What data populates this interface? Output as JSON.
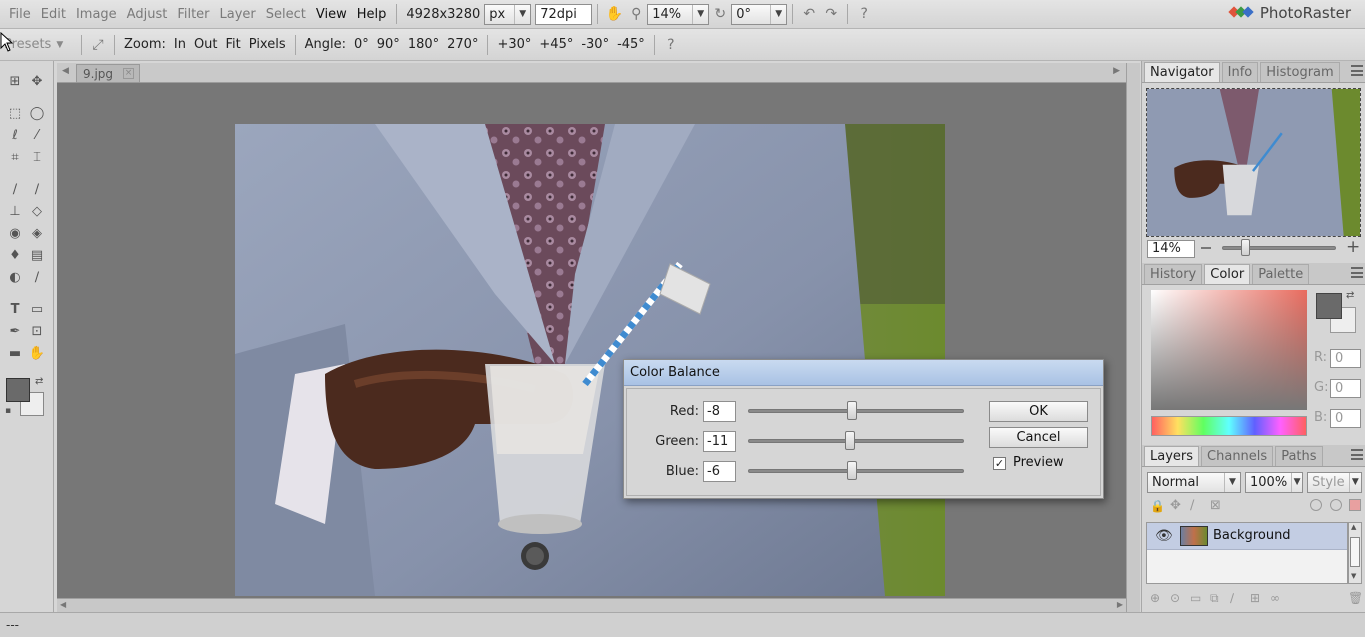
{
  "menu": [
    "File",
    "Edit",
    "Image",
    "Adjust",
    "Filter",
    "Layer",
    "Select",
    "View",
    "Help"
  ],
  "menu_enabled": [
    false,
    false,
    false,
    false,
    false,
    false,
    false,
    true,
    true
  ],
  "image_size": "4928x3280",
  "unit": "px",
  "dpi": "72dpi",
  "zoom_value": "14%",
  "rotate_value": "0°",
  "app_name": "PhotoRaster",
  "options": {
    "presets": "Presets",
    "zoom_label": "Zoom:",
    "zoom_in": "In",
    "zoom_out": "Out",
    "zoom_fit": "Fit",
    "zoom_pixels": "Pixels",
    "angle_label": "Angle:",
    "angles": [
      "0°",
      "90°",
      "180°",
      "270°",
      "+30°",
      "+45°",
      "-30°",
      "-45°"
    ]
  },
  "document": {
    "tab_name": "9.jpg"
  },
  "navigator": {
    "tabs": [
      "Navigator",
      "Info",
      "Histogram"
    ],
    "zoom": "14%",
    "slider_fraction": 0.2
  },
  "color_panel": {
    "tabs": [
      "History",
      "Color",
      "Palette"
    ],
    "r_label": "R:",
    "g_label": "G:",
    "b_label": "B:",
    "r": "0",
    "g": "0",
    "b": "0",
    "foreground": "#6a6a6a",
    "background": "#eeeeee"
  },
  "layers": {
    "tabs": [
      "Layers",
      "Channels",
      "Paths"
    ],
    "blend_mode": "Normal",
    "opacity": "100%",
    "style": "Style",
    "items": [
      {
        "name": "Background",
        "visible": true
      }
    ]
  },
  "dialog": {
    "title": "Color Balance",
    "red_label": "Red:",
    "red": "-8",
    "red_fraction": 0.48,
    "green_label": "Green:",
    "green": "-11",
    "green_fraction": 0.47,
    "blue_label": "Blue:",
    "blue": "-6",
    "blue_fraction": 0.48,
    "ok": "OK",
    "cancel": "Cancel",
    "preview_label": "Preview",
    "preview_checked": true
  },
  "status": "---"
}
